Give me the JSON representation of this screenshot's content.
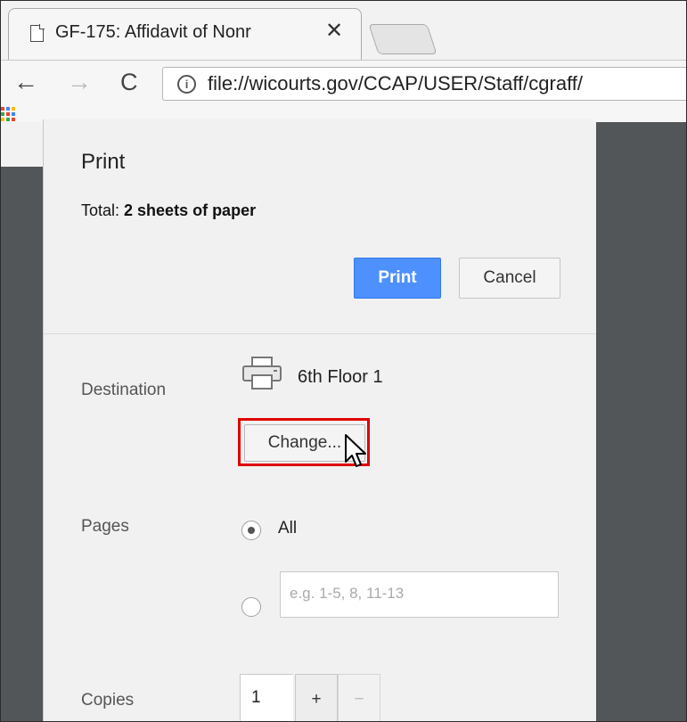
{
  "browser": {
    "tab_title": "GF-175: Affidavit of Nonr",
    "tab_close": "✕",
    "url": "file://wicourts.gov/CCAP/USER/Staff/cgraff/",
    "nav": {
      "back": "←",
      "forward": "→",
      "reload": "C"
    },
    "info_icon": "i"
  },
  "print_dialog": {
    "title": "Print",
    "total_prefix": "Total: ",
    "total_value": "2 sheets of paper",
    "print_button": "Print",
    "cancel_button": "Cancel",
    "destination": {
      "label": "Destination",
      "printer_name": "6th Floor 1",
      "change_button": "Change..."
    },
    "pages": {
      "label": "Pages",
      "all_label": "All",
      "selected": "All",
      "custom_placeholder": "e.g. 1-5, 8, 11-13"
    },
    "copies": {
      "label": "Copies",
      "value": "1",
      "plus": "+",
      "minus": "−"
    }
  },
  "colors": {
    "accent_blue": "#4d90fe",
    "highlight_red": "#e00000",
    "page_dark": "#525659"
  }
}
